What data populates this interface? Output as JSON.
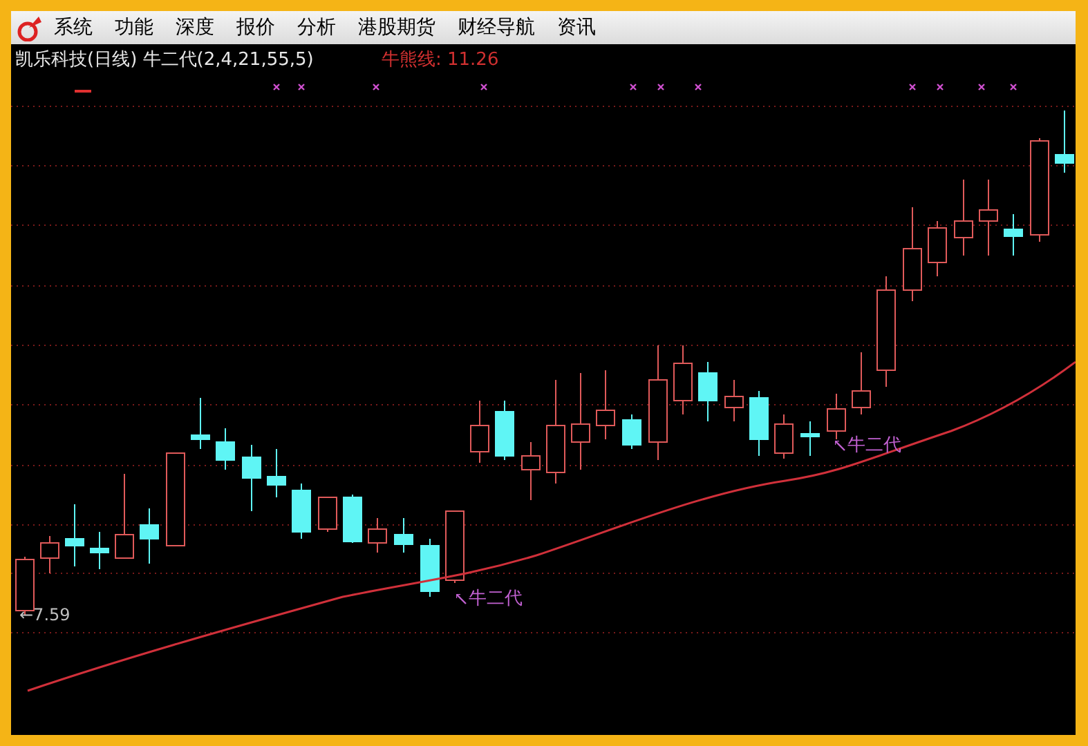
{
  "menu": [
    {
      "label": "系统"
    },
    {
      "label": "功能"
    },
    {
      "label": "深度"
    },
    {
      "label": "报价"
    },
    {
      "label": "分析"
    },
    {
      "label": "港股期货"
    },
    {
      "label": "财经导航"
    },
    {
      "label": "资讯"
    }
  ],
  "chart": {
    "title": "凯乐科技(日线) 牛二代(2,4,21,55,5)",
    "legend": "牛熊线: 11.26",
    "low_label": "←7.59",
    "annotations": [
      {
        "text": "牛二代"
      },
      {
        "text": "牛二代"
      }
    ]
  }
}
